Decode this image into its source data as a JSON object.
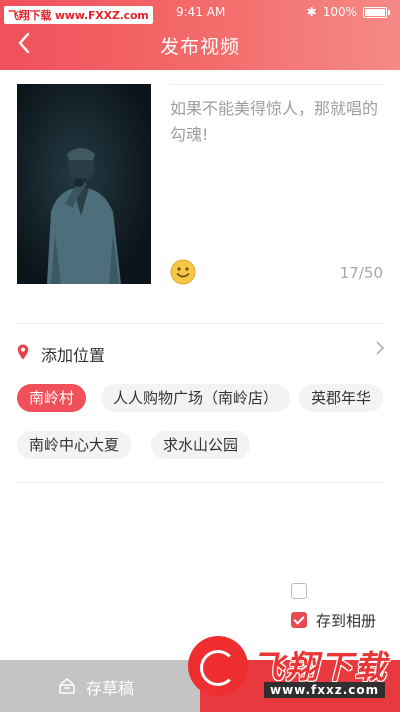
{
  "status_bar": {
    "watermark": "飞翔下载 www.FXXZ.com",
    "time": "9:41 AM",
    "battery": "100%"
  },
  "header": {
    "title": "发布视频",
    "back_icon": "chevron-left-icon"
  },
  "post": {
    "caption": "如果不能美得惊人，那就唱的勾魂!",
    "char_count": "17/50",
    "emoji_icon": "smiley-icon"
  },
  "location": {
    "label": "添加位置",
    "icon": "map-pin-icon",
    "arrow_icon": "chevron-right-icon",
    "chips": [
      {
        "label": "南岭村",
        "selected": true
      },
      {
        "label": "人人购物广场（南岭店）",
        "selected": false
      },
      {
        "label": "英郡年华",
        "selected": false
      },
      {
        "label": "南岭中心大夏",
        "selected": false
      },
      {
        "label": "求水山公园",
        "selected": false
      }
    ]
  },
  "options": {
    "save_to_album_label": "存到相册",
    "save_to_album_checked": true,
    "extra_checkbox_checked": false
  },
  "footer": {
    "draft_label": "存草稿",
    "draft_icon": "draft-box-icon"
  },
  "watermark_logo": {
    "text": "飞翔下载",
    "url": "www.fxxz.com"
  },
  "colors": {
    "accent": "#f0505a",
    "publish": "#e8393f",
    "draft": "#c4c4c4"
  }
}
